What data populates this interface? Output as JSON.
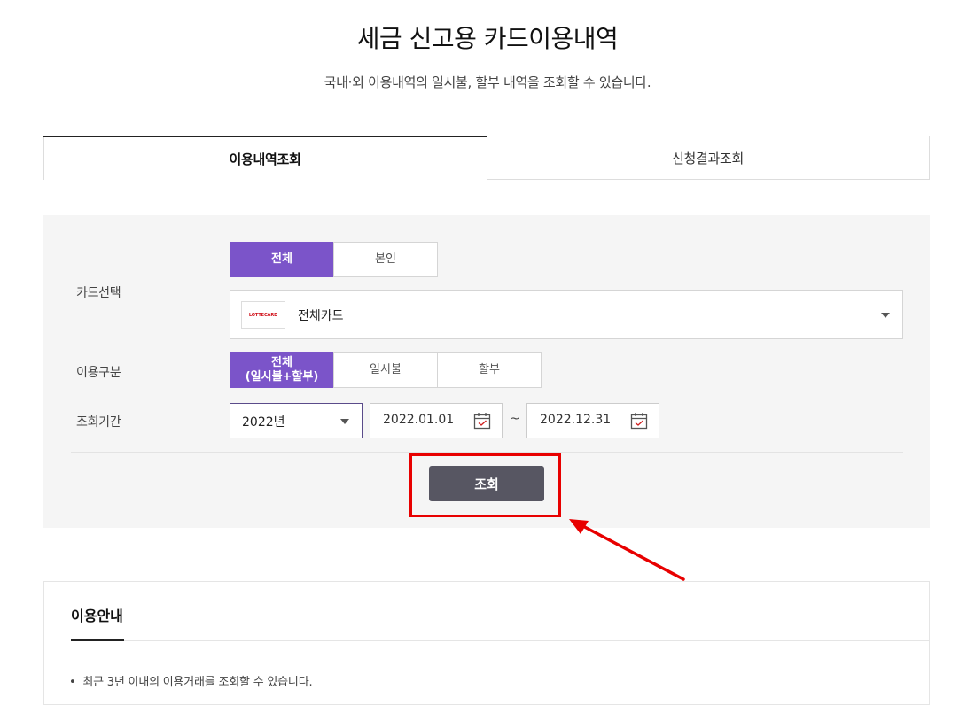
{
  "header": {
    "title": "세금 신고용 카드이용내역",
    "subtitle": "국내·외 이용내역의 일시불, 할부 내역을 조회할 수 있습니다."
  },
  "tabs": [
    {
      "label": "이용내역조회",
      "active": true
    },
    {
      "label": "신청결과조회",
      "active": false
    }
  ],
  "form": {
    "card_select": {
      "label": "카드선택",
      "segments": [
        "전체",
        "본인"
      ],
      "selected_segment": "전체",
      "card_logo_text": "LOTTECARD",
      "card_value": "전체카드"
    },
    "usage_type": {
      "label": "이용구분",
      "options": [
        "전체\n(일시불+할부)",
        "일시불",
        "할부"
      ],
      "selected": "전체\n(일시불+할부)"
    },
    "period": {
      "label": "조회기간",
      "year_value": "2022년",
      "start_date": "2022.01.01",
      "separator": "~",
      "end_date": "2022.12.31"
    },
    "search_button": "조회"
  },
  "info": {
    "title": "이용안내",
    "items": [
      "최근 3년 이내의 이용거래를 조회할 수 있습니다."
    ]
  },
  "colors": {
    "accent": "#7b54c9",
    "button": "#575662",
    "highlight": "#e80000",
    "panel_bg": "#f5f5f5"
  },
  "icons": [
    "calendar-icon",
    "chevron-down-icon",
    "arrow-annotation"
  ]
}
